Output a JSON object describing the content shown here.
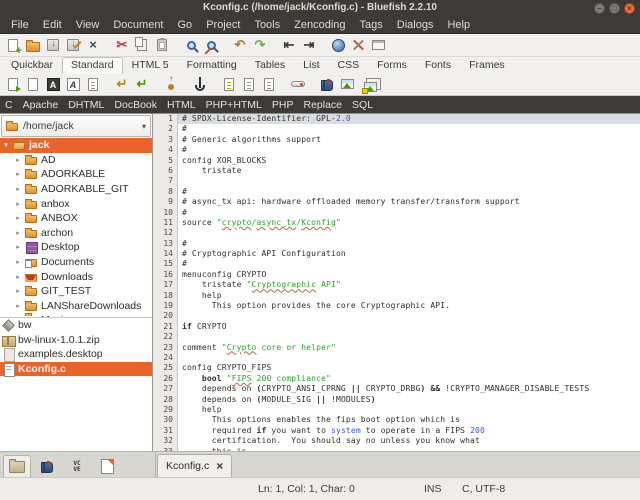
{
  "window": {
    "title": "Kconfig.c (/home/jack/Kconfig.c) - Bluefish 2.2.10",
    "controls": [
      "minimize",
      "maximize",
      "close"
    ]
  },
  "menubar": {
    "items": [
      "File",
      "Edit",
      "View",
      "Document",
      "Go",
      "Project",
      "Tools",
      "Zencoding",
      "Tags",
      "Dialogs",
      "Help"
    ]
  },
  "toolbar_main": {
    "icons": [
      {
        "name": "new-file",
        "type": "ic-page ic-pageplus"
      },
      {
        "name": "open-file",
        "type": "ic-folderbig"
      },
      {
        "name": "save",
        "type": "ic-save"
      },
      {
        "name": "save-as",
        "type": "ic-save ic-saveas"
      },
      {
        "name": "close-document",
        "glyph": "×",
        "color": "#4a4a46",
        "gap_after": true
      },
      {
        "name": "cut",
        "glyph": "✂",
        "color": "#cc3333"
      },
      {
        "name": "copy",
        "type": "ic-copy"
      },
      {
        "name": "paste",
        "type": "ic-paste",
        "gap_after": true
      },
      {
        "name": "find",
        "type": "ic-mag"
      },
      {
        "name": "find-replace",
        "type": "ic-mag ic-magedit",
        "gap_after": true
      },
      {
        "name": "undo",
        "glyph": "↶",
        "color": "#b07c2a"
      },
      {
        "name": "redo",
        "glyph": "↷",
        "color": "#73a946",
        "gap_after": true
      },
      {
        "name": "unindent",
        "glyph": "⇤",
        "color": "#3a3a38"
      },
      {
        "name": "indent",
        "glyph": "⇥",
        "color": "#3a3a38",
        "gap_after": true
      },
      {
        "name": "preview-in-browser",
        "type": "ic-globe"
      },
      {
        "name": "preferences",
        "type": "ic-tools"
      },
      {
        "name": "floating-window",
        "type": "ic-frame"
      }
    ]
  },
  "quickbar": {
    "tabs": [
      {
        "label": "Quickbar",
        "active": false
      },
      {
        "label": "Standard",
        "active": true
      },
      {
        "label": "HTML 5",
        "active": false
      },
      {
        "label": "Formatting",
        "active": false
      },
      {
        "label": "Tables",
        "active": false
      },
      {
        "label": "List",
        "active": false
      },
      {
        "label": "CSS",
        "active": false
      },
      {
        "label": "Forms",
        "active": false
      },
      {
        "label": "Fonts",
        "active": false
      },
      {
        "label": "Frames",
        "active": false
      }
    ]
  },
  "toolbar_html": {
    "icons": [
      {
        "name": "quickstart",
        "type": "ic-page ic-pageplay"
      },
      {
        "name": "body",
        "type": "ic-page"
      },
      {
        "name": "bold",
        "type": "ic-boxA",
        "text": "A"
      },
      {
        "name": "italic",
        "type": "ic-boxAi",
        "text": "A"
      },
      {
        "name": "paragraph",
        "type": "ic-page ic-lines",
        "gap_after": true
      },
      {
        "name": "break",
        "glyph": "↵",
        "color": "#b5890e"
      },
      {
        "name": "break-clear",
        "glyph": "↵",
        "color": "#4e9a06",
        "gap_after": true
      },
      {
        "name": "non-breaking-space",
        "type": "ic-nbsp",
        "gap_after": true
      },
      {
        "name": "anchor",
        "type": "ic-anchor",
        "gap_after": true
      },
      {
        "name": "comment",
        "type": "ic-page ic-ylines"
      },
      {
        "name": "center-justify",
        "type": "ic-page ic-lines"
      },
      {
        "name": "right-justify",
        "type": "ic-page ic-lines",
        "gap_after": true
      },
      {
        "name": "rule",
        "type": "ic-rule",
        "gap_after": true
      },
      {
        "name": "email",
        "type": "ic-book"
      },
      {
        "name": "image",
        "type": "ic-img"
      },
      {
        "name": "multi-thumbnail",
        "type": "ic-img ic-imgs"
      }
    ]
  },
  "langbar": {
    "items": [
      "C",
      "Apache",
      "DHTML",
      "DocBook",
      "HTML",
      "PHP+HTML",
      "PHP",
      "Replace",
      "SQL"
    ]
  },
  "sidebar": {
    "dir_dropdown": {
      "value": "/home/jack",
      "arrow": "▾"
    },
    "tree": [
      {
        "label": "jack",
        "icon": "folder-open",
        "expander": "▾",
        "selected": true,
        "indent": 0
      },
      {
        "label": "AD",
        "icon": "folder",
        "expander": "▸",
        "indent": 1
      },
      {
        "label": "ADORKABLE",
        "icon": "folder",
        "expander": "▸",
        "indent": 1
      },
      {
        "label": "ADORKABLE_GIT",
        "icon": "folder",
        "expander": "▸",
        "indent": 1
      },
      {
        "label": "anbox",
        "icon": "folder",
        "expander": "▸",
        "indent": 1
      },
      {
        "label": "ANBOX",
        "icon": "folder",
        "expander": "▸",
        "indent": 1
      },
      {
        "label": "archon",
        "icon": "folder",
        "expander": "▸",
        "indent": 1
      },
      {
        "label": "Desktop",
        "icon": "desktop",
        "expander": "▸",
        "indent": 1
      },
      {
        "label": "Documents",
        "icon": "folder documents",
        "expander": "▸",
        "indent": 1
      },
      {
        "label": "Downloads",
        "icon": "folder downloads",
        "expander": "▸",
        "indent": 1
      },
      {
        "label": "GIT_TEST",
        "icon": "folder",
        "expander": "▸",
        "indent": 1
      },
      {
        "label": "LANShareDownloads",
        "icon": "folder",
        "expander": "▸",
        "indent": 1
      },
      {
        "label": "Music",
        "icon": "folder music",
        "expander": "▸",
        "indent": 1
      }
    ],
    "files": [
      {
        "label": "bw",
        "icon": "binary"
      },
      {
        "label": "bw-linux-1.0.1.zip",
        "icon": "archive"
      },
      {
        "label": "examples.desktop",
        "icon": "desktop-entry"
      },
      {
        "label": "Kconfig.c",
        "icon": "source",
        "selected": true
      }
    ],
    "bottom_tabs": [
      {
        "name": "file-browser",
        "active": true
      },
      {
        "name": "bookmarks",
        "active": false
      },
      {
        "name": "character-map",
        "active": false,
        "text": "VC\nVE"
      },
      {
        "name": "snippets",
        "active": false
      }
    ]
  },
  "editor": {
    "current_line": 1,
    "lines": [
      {
        "hl": true,
        "segs": [
          [
            "# SPDX-License-Identifier: GPL-",
            "d"
          ],
          [
            "2.0",
            "n"
          ]
        ]
      },
      {
        "segs": [
          [
            "#",
            "d"
          ]
        ]
      },
      {
        "segs": [
          [
            "# Generic algorithms support",
            "d"
          ]
        ]
      },
      {
        "segs": [
          [
            "#",
            "d"
          ]
        ]
      },
      {
        "segs": [
          [
            "config XOR_BLOCKS",
            "d"
          ]
        ]
      },
      {
        "segs": [
          [
            "    tristate",
            "d"
          ]
        ]
      },
      {
        "segs": []
      },
      {
        "segs": [
          [
            "#",
            "d"
          ]
        ]
      },
      {
        "segs": [
          [
            "# async_tx api: hardware offloaded memory transfer/transform support",
            "d"
          ]
        ]
      },
      {
        "segs": [
          [
            "#",
            "d"
          ]
        ]
      },
      {
        "segs": [
          [
            "source ",
            "d"
          ],
          [
            "\"",
            "s"
          ],
          [
            "crypto",
            "u"
          ],
          [
            "/",
            "s"
          ],
          [
            "async_tx",
            "u"
          ],
          [
            "/",
            "s"
          ],
          [
            "Kconfig",
            "u"
          ],
          [
            "\"",
            "s"
          ]
        ]
      },
      {
        "segs": []
      },
      {
        "segs": [
          [
            "#",
            "d"
          ]
        ]
      },
      {
        "segs": [
          [
            "# Cryptographic API Configuration",
            "d"
          ]
        ]
      },
      {
        "segs": [
          [
            "#",
            "d"
          ]
        ]
      },
      {
        "segs": [
          [
            "menuconfig CRYPTO",
            "d"
          ]
        ]
      },
      {
        "segs": [
          [
            "    tristate ",
            "d"
          ],
          [
            "\"",
            "s"
          ],
          [
            "Cryptographic",
            "u"
          ],
          [
            " API\"",
            "s"
          ]
        ]
      },
      {
        "segs": [
          [
            "    help",
            "d"
          ]
        ]
      },
      {
        "segs": [
          [
            "      This option provides the core Cryptographic API.",
            "d"
          ]
        ]
      },
      {
        "segs": []
      },
      {
        "segs": [
          [
            "if",
            "k"
          ],
          [
            " CRYPTO",
            "d"
          ]
        ]
      },
      {
        "segs": []
      },
      {
        "segs": [
          [
            "comment ",
            "d"
          ],
          [
            "\"",
            "s"
          ],
          [
            "Crypto",
            "u"
          ],
          [
            " core or helper\"",
            "s"
          ]
        ]
      },
      {
        "segs": []
      },
      {
        "segs": [
          [
            "config CRYPTO_FIPS",
            "d"
          ]
        ]
      },
      {
        "segs": [
          [
            "    ",
            "d"
          ],
          [
            "bool",
            "k"
          ],
          [
            " ",
            "d"
          ],
          [
            "\"",
            "s"
          ],
          [
            "FIPS",
            "u"
          ],
          [
            " 200 compliance\"",
            "s"
          ]
        ]
      },
      {
        "segs": [
          [
            "    depends on ",
            "d"
          ],
          [
            "(",
            "k"
          ],
          [
            "CRYPTO_ANSI_CPRNG ",
            "d"
          ],
          [
            "||",
            "k"
          ],
          [
            " CRYPTO_DRBG",
            "d"
          ],
          [
            ")",
            "k"
          ],
          [
            " ",
            "d"
          ],
          [
            "&&",
            "k"
          ],
          [
            " !CRYPTO_MANAGER_DISABLE_TESTS",
            "d"
          ]
        ]
      },
      {
        "segs": [
          [
            "    depends on ",
            "d"
          ],
          [
            "(",
            "k"
          ],
          [
            "MODULE_SIG ",
            "d"
          ],
          [
            "||",
            "k"
          ],
          [
            " !MODULES",
            "d"
          ],
          [
            ")",
            "k"
          ]
        ]
      },
      {
        "segs": [
          [
            "    help",
            "d"
          ]
        ]
      },
      {
        "segs": [
          [
            "      This options enables the fips boot option which is",
            "d"
          ]
        ]
      },
      {
        "segs": [
          [
            "      required ",
            "d"
          ],
          [
            "if",
            "k"
          ],
          [
            " you want to ",
            "d"
          ],
          [
            "system",
            "n"
          ],
          [
            " to operate in a FIPS ",
            "d"
          ],
          [
            "200",
            "n"
          ]
        ]
      },
      {
        "segs": [
          [
            "      certification.  You should say no unless you know what",
            "d"
          ]
        ]
      },
      {
        "segs": [
          [
            "      this is.",
            "d"
          ]
        ]
      }
    ]
  },
  "doc_tab": {
    "label": "Kconfig.c",
    "close_glyph": "×"
  },
  "statusbar": {
    "position": "Ln: 1, Col: 1, Char: 0",
    "mode": "INS",
    "doctype": "C, UTF-8"
  },
  "colors": {
    "titlebar_bg": "#3c3b37",
    "selection_orange": "#e9632a",
    "current_line_bg": "#d9dde2",
    "string_green": "#2f9e2f",
    "number_blue": "#3956c6",
    "close_button": "#ee6b3d"
  }
}
